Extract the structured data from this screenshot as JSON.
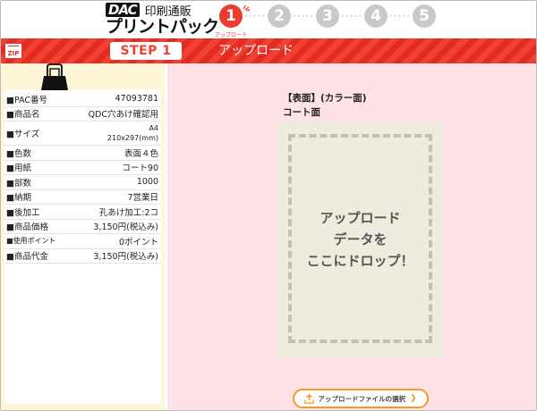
{
  "header": {
    "logo_top_mark": "DAC",
    "logo_subtitle": "印刷通販",
    "logo_main": "プリントパック",
    "steps": [
      {
        "number": "1",
        "active": true,
        "caption": "アップロード"
      },
      {
        "number": "2",
        "active": false
      },
      {
        "number": "3",
        "active": false
      },
      {
        "number": "4",
        "active": false
      },
      {
        "number": "5",
        "active": false
      }
    ],
    "step_separator": "·····"
  },
  "step_bar": {
    "zip_label": "ZIP",
    "step_label": "STEP 1",
    "title": "アップロード"
  },
  "order_info": {
    "rows": [
      {
        "label": "■PAC番号",
        "value": "47093781"
      },
      {
        "label": "■商品名",
        "value": "QDC穴あけ確認用"
      },
      {
        "label": "■サイズ",
        "value_line1": "A4",
        "value_line2": "210x297(mm)"
      },
      {
        "label": "■色数",
        "value": "表面４色"
      },
      {
        "label": "■用紙",
        "value": "コート90"
      },
      {
        "label": "■部数",
        "value": "1000"
      },
      {
        "label": "■納期",
        "value": "7営業日"
      },
      {
        "label": "■後加工",
        "value": "孔あけ加工:2コ"
      },
      {
        "label": "■商品価格",
        "value": "3,150円(税込み)"
      },
      {
        "label": "■使用ポイント",
        "value": "0ポイント"
      },
      {
        "label": "■商品代金",
        "value": "3,150円(税込み)"
      }
    ]
  },
  "upload": {
    "face_title": "【表面】(カラー面)",
    "face_subtitle": "コート面",
    "drop_line1": "アップロード",
    "drop_line2": "データを",
    "drop_line3": "ここにドロップ！",
    "select_button_label": "アップロードファイルの選択"
  },
  "colors": {
    "accent_red": "#ef4134",
    "step_inactive": "#c9c9c9",
    "left_panel_bg": "#fdf7d8",
    "main_bg": "#fde3e5",
    "drop_bg": "#f0ebdf",
    "button_border": "#f39a27"
  }
}
